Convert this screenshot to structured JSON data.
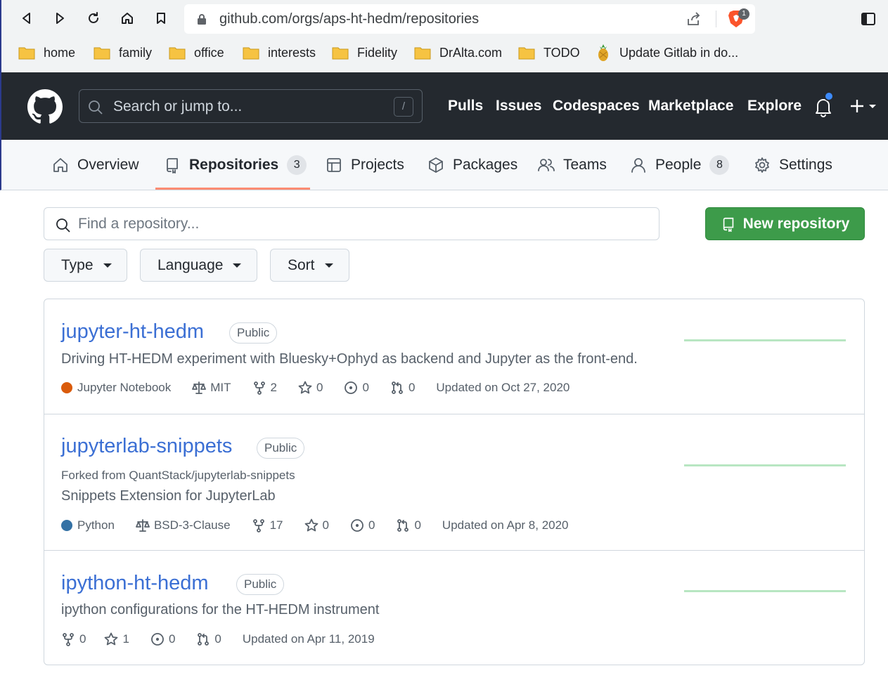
{
  "browser": {
    "url": "github.com/orgs/aps-ht-hedm/repositories",
    "shields_count": "1",
    "bookmarks": [
      {
        "label": "home",
        "icon": "folder-icon"
      },
      {
        "label": "family",
        "icon": "folder-icon"
      },
      {
        "label": "office",
        "icon": "folder-icon"
      },
      {
        "label": "interests",
        "icon": "folder-icon"
      },
      {
        "label": "Fidelity",
        "icon": "folder-icon"
      },
      {
        "label": "DrAlta.com",
        "icon": "folder-icon"
      },
      {
        "label": "TODO",
        "icon": "folder-icon"
      },
      {
        "label": "Update Gitlab in do...",
        "icon": "pineapple-icon"
      }
    ]
  },
  "header": {
    "search_placeholder": "Search or jump to...",
    "search_shortcut": "/",
    "nav": [
      "Pulls",
      "Issues",
      "Codespaces",
      "Marketplace",
      "Explore"
    ]
  },
  "org_tabs": [
    {
      "label": "Overview",
      "icon": "home-icon",
      "count": null
    },
    {
      "label": "Repositories",
      "icon": "repo-icon",
      "count": "3",
      "active": true
    },
    {
      "label": "Projects",
      "icon": "table-icon",
      "count": null
    },
    {
      "label": "Packages",
      "icon": "package-icon",
      "count": null
    },
    {
      "label": "Teams",
      "icon": "people-icon",
      "count": null
    },
    {
      "label": "People",
      "icon": "person-icon",
      "count": "8"
    },
    {
      "label": "Settings",
      "icon": "gear-icon",
      "count": null
    }
  ],
  "filters": {
    "find_placeholder": "Find a repository...",
    "new_repo_label": "New repository",
    "type_label": "Type",
    "language_label": "Language",
    "sort_label": "Sort"
  },
  "repos": [
    {
      "name": "jupyter-ht-hedm",
      "visibility": "Public",
      "forked_from": "",
      "description": "Driving HT-HEDM experiment with Bluesky+Ophyd as backend and Jupyter as the front-end.",
      "language": "Jupyter Notebook",
      "language_color": "#DA5B0B",
      "license": "MIT",
      "forks": "2",
      "stars": "0",
      "issues": "0",
      "pulls": "0",
      "updated": "Updated on Oct 27, 2020"
    },
    {
      "name": "jupyterlab-snippets",
      "visibility": "Public",
      "forked_from": "Forked from QuantStack/jupyterlab-snippets",
      "description": "Snippets Extension for JupyterLab",
      "language": "Python",
      "language_color": "#3572A5",
      "license": "BSD-3-Clause",
      "forks": "17",
      "stars": "0",
      "issues": "0",
      "pulls": "0",
      "updated": "Updated on Apr 8, 2020"
    },
    {
      "name": "ipython-ht-hedm",
      "visibility": "Public",
      "forked_from": "",
      "description": "ipython configurations for the HT-HEDM instrument",
      "language": "",
      "language_color": "",
      "license": "",
      "forks": "0",
      "stars": "1",
      "issues": "0",
      "pulls": "0",
      "updated": "Updated on Apr 11, 2019"
    }
  ]
}
